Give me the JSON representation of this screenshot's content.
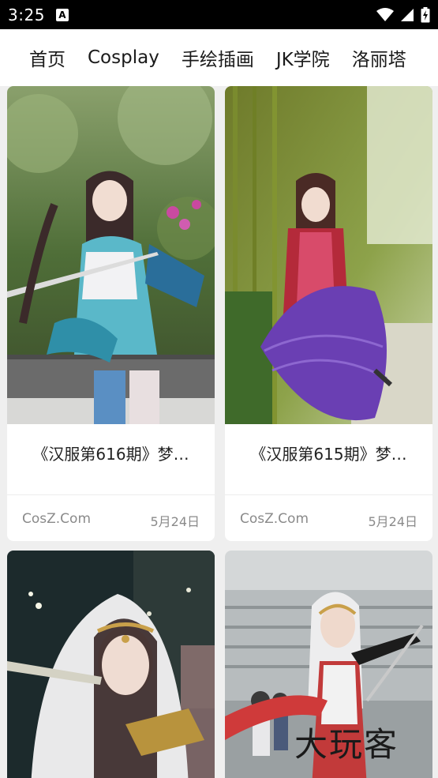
{
  "status": {
    "time": "3:25",
    "notification_icon": "A",
    "icons": [
      "wifi-icon",
      "signal-icon",
      "battery-charging-icon"
    ]
  },
  "tabs": [
    {
      "label": "首页"
    },
    {
      "label": "Cosplay"
    },
    {
      "label": "手绘插画"
    },
    {
      "label": "JK学院"
    },
    {
      "label": "洛丽塔"
    }
  ],
  "cards": [
    {
      "title": "《汉服第616期》梦…",
      "source": "CosZ.Com",
      "date": "5月24日"
    },
    {
      "title": "《汉服第615期》梦…",
      "source": "CosZ.Com",
      "date": "5月24日"
    },
    {
      "title": "",
      "source": "",
      "date": ""
    },
    {
      "title": "",
      "source": "",
      "date": "",
      "watermark": "大玩客"
    }
  ],
  "colors": {
    "status_bar": "#000000",
    "tab_background": "#ffffff",
    "grid_background": "#efefef",
    "meta_text": "#8a8a8a"
  }
}
